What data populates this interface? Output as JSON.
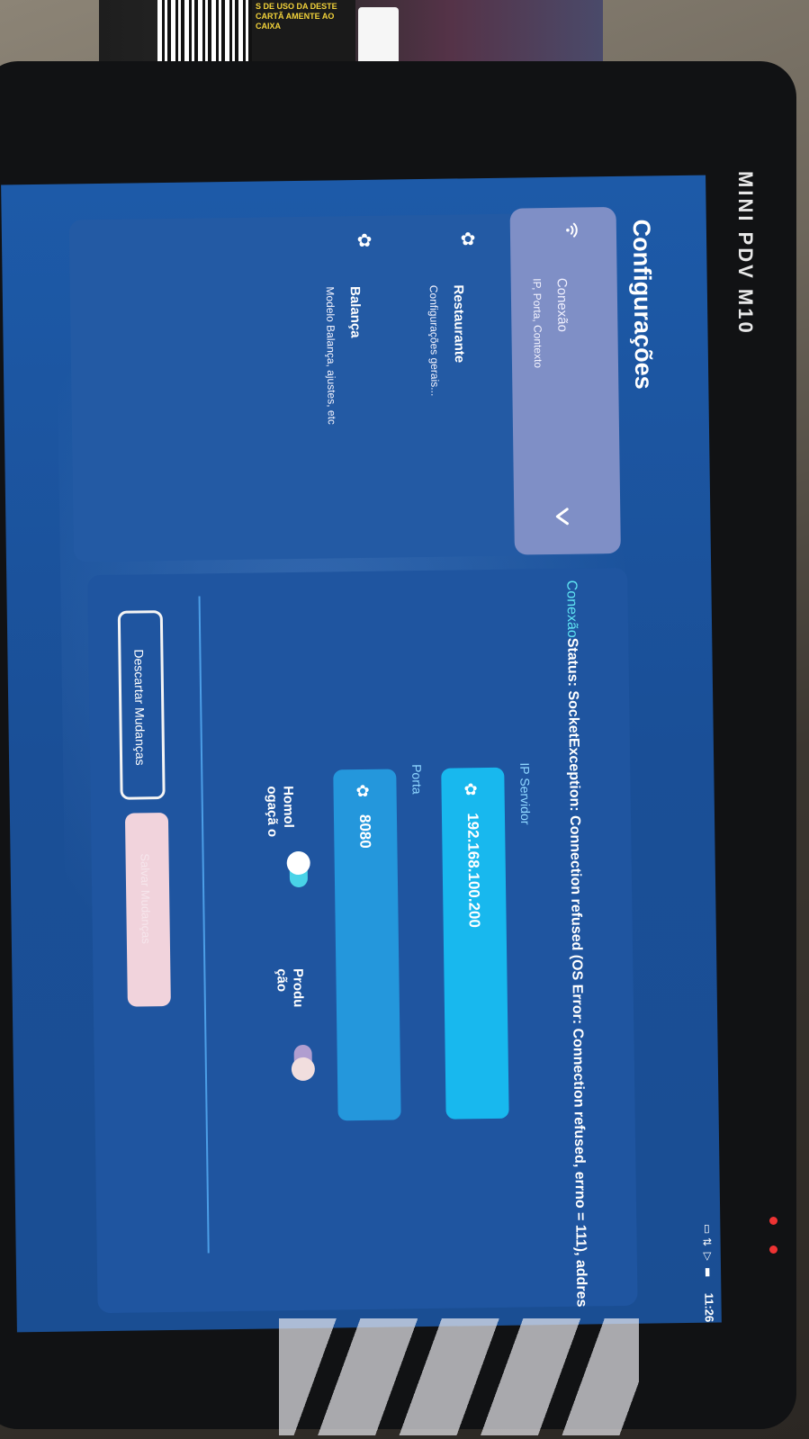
{
  "device": {
    "brand": "MINI PDV M10"
  },
  "status_bar": {
    "time": "11:26",
    "icons": [
      "vibrate-icon",
      "data-icon",
      "wifi-icon",
      "battery-icon"
    ]
  },
  "flyer": {
    "text": "S DE USO DA DESTE CARTÃ AMENTE AO CAIXA"
  },
  "page": {
    "title": "Configurações"
  },
  "menu": {
    "items": [
      {
        "label": "Conexão",
        "subtitle": "IP, Porta, Contexto",
        "icon": "wifi-icon",
        "selected": true
      },
      {
        "label": "Restaurante",
        "subtitle": "Configurações gerais...",
        "icon": "gear-icon",
        "selected": false
      },
      {
        "label": "Balança",
        "subtitle": "Modelo Balança, ajustes, etc",
        "icon": "gear-icon",
        "selected": false
      }
    ]
  },
  "connection": {
    "title": "Conexão",
    "status": "Status: SocketException: Connection refused (OS Error: Connection refused, errno = 111), addres",
    "ip_label": "IP Servidor",
    "ip_value": "192.168.100.200",
    "port_label": "Porta",
    "port_value": "8080",
    "env_homolog": "Homol ogaçã o",
    "env_prod": "Produ ção",
    "homolog_on": true,
    "prod_on": false
  },
  "actions": {
    "discard_label": "Descartar Mudanças",
    "save_label": "Salvar Mudanças"
  },
  "colors": {
    "screen_bg": "#1d5aa8",
    "accent": "#5fe3f2",
    "field_bg": "#18b8ee",
    "selected_item_bg": "#7f8fc6"
  }
}
